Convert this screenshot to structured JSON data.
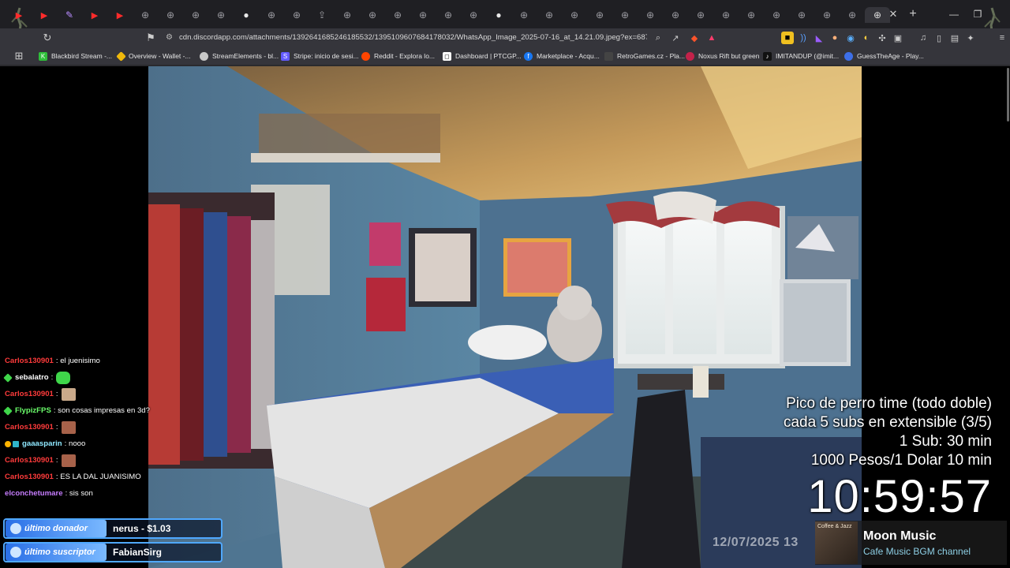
{
  "browser": {
    "url": "cdn.discordapp.com/attachments/1392641685246185532/1395109607684178032/WhatsApp_Image_2025-07-16_at_14.21.09.jpeg?ex=687be...",
    "bookmarks": [
      {
        "label": "Blackbird Stream -...",
        "icon": "blackbird-icon",
        "color": "#2fbf3a"
      },
      {
        "label": "Overview - Wallet -...",
        "icon": "wallet-icon",
        "color": "#f0b90b"
      },
      {
        "label": "StreamElements - bl...",
        "icon": "streamelements-icon",
        "color": "#c8c8c8"
      },
      {
        "label": "Stripe: inicio de sesi...",
        "icon": "stripe-icon",
        "color": "#635bff"
      },
      {
        "label": "Reddit - Explora lo...",
        "icon": "reddit-icon",
        "color": "#ff4500"
      },
      {
        "label": "Dashboard | PTCGP...",
        "icon": "dashboard-icon",
        "color": "#ffffff"
      },
      {
        "label": "Marketplace - Acqu...",
        "icon": "facebook-icon",
        "color": "#1877f2"
      },
      {
        "label": "RetroGames.cz - Pla...",
        "icon": "retrogames-icon",
        "color": "#444444"
      },
      {
        "label": "Noxus Rift but green",
        "icon": "noxus-icon",
        "color": "#c3224a"
      },
      {
        "label": "IMITANDUP (@imit...",
        "icon": "tiktok-icon",
        "color": "#111111"
      },
      {
        "label": "GuessTheAge - Play...",
        "icon": "guesstheage-icon",
        "color": "#3d6fe8"
      }
    ]
  },
  "chat": {
    "messages": [
      {
        "user": "Carlos130901",
        "text": ": el juenisimo",
        "color": "#ff3b3b",
        "emote": false
      },
      {
        "user": "sebalatro",
        "text": ":",
        "color": "#ffffff",
        "emote": true,
        "emote_color": "#3fd64a",
        "badge": "#3fd64a"
      },
      {
        "user": "Carlos130901",
        "text": ":",
        "color": "#ff3b3b",
        "emote": true,
        "emote_color": "#c9a98a"
      },
      {
        "user": "FlypizFPS",
        "text": ": son cosas impresas en 3d?",
        "color": "#6bff6b",
        "emote": false,
        "badge": "#3fd64a"
      },
      {
        "user": "Carlos130901",
        "text": ":",
        "color": "#ff3b3b",
        "emote": true,
        "emote_color": "#a7624a"
      },
      {
        "user": "gaaasparin",
        "text": ": nooo",
        "color": "#8fe8ff",
        "emote": false,
        "badge": "#ffb400"
      },
      {
        "user": "Carlos130901",
        "text": ":",
        "color": "#ff3b3b",
        "emote": true,
        "emote_color": "#a7624a"
      },
      {
        "user": "Carlos130901",
        "text": ": ES LA DAL JUANISIMO",
        "color": "#ff3b3b",
        "emote": false
      },
      {
        "user": "elconchetumare",
        "text": ": sis son",
        "color": "#c77dff",
        "emote": false
      }
    ]
  },
  "donor": {
    "tag": "último donador",
    "value": "nerus - $1.03"
  },
  "subscriber": {
    "tag": "último suscriptor",
    "value": "FabianSirg"
  },
  "timer": {
    "line1": "Pico de perro time (todo doble)",
    "line2": "cada 5 subs en extensible (3/5)",
    "line3": "1 Sub: 30 min",
    "line4": "1000 Pesos/1 Dolar 10 min",
    "clock": "10:59:57"
  },
  "photo": {
    "timestamp": "12/07/2025 13"
  },
  "music": {
    "cover_label": "Coffee & Jazz",
    "title": "Moon Music",
    "channel": "Cafe Music BGM channel"
  }
}
